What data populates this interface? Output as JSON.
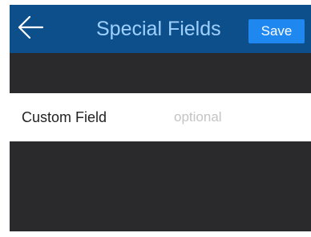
{
  "header": {
    "back_icon": "arrow-left-icon",
    "title": "Special Fields",
    "save_label": "Save"
  },
  "form": {
    "custom_field": {
      "label": "Custom Field",
      "value": "",
      "placeholder": "optional"
    }
  },
  "colors": {
    "header_bg": "#0d4f8b",
    "title_text": "#9ed0ff",
    "save_button_bg": "#1e88f0",
    "screen_bg": "#2a2a2c",
    "row_bg": "#ffffff",
    "placeholder_text": "#c4c4c4"
  }
}
